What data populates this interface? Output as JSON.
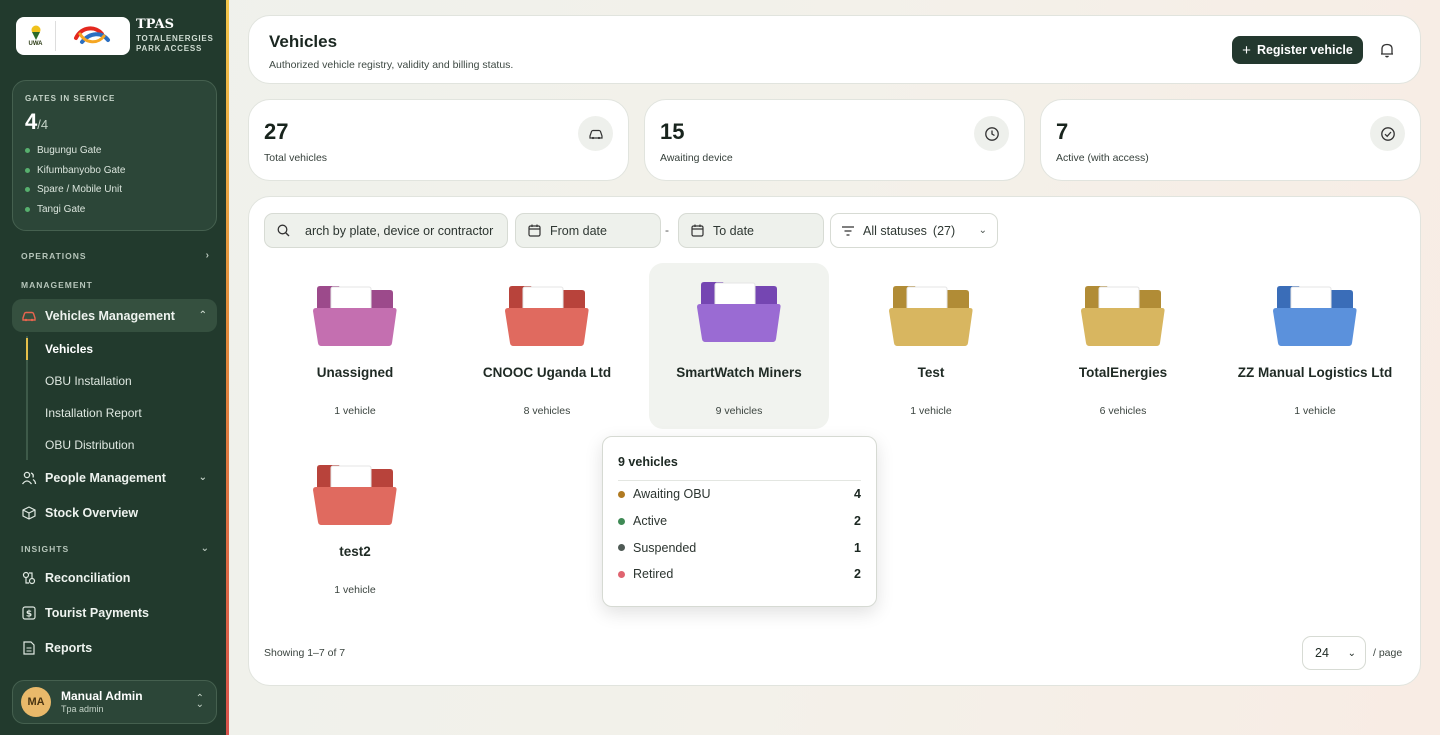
{
  "brand": {
    "title": "TPAS",
    "subtitle_line1": "TOTALENERGIES",
    "subtitle_line2": "PARK ACCESS",
    "uwa_logo_text": "UWA"
  },
  "gates": {
    "label": "GATES IN SERVICE",
    "in_service": "4",
    "total": "/4",
    "items": [
      "Bugungu Gate",
      "Kifumbanyobo Gate",
      "Spare / Mobile Unit",
      "Tangi Gate"
    ],
    "dot_color": "#57b06e"
  },
  "nav": {
    "operations_label": "OPERATIONS",
    "management_label": "MANAGEMENT",
    "insights_label": "INSIGHTS",
    "vehicles_management": "Vehicles Management",
    "vehicles_sub": [
      "Vehicles",
      "OBU Installation",
      "Installation Report",
      "OBU Distribution"
    ],
    "people_management": "People Management",
    "stock_overview": "Stock Overview",
    "reconciliation": "Reconciliation",
    "tourist_payments": "Tourist Payments",
    "reports": "Reports"
  },
  "user": {
    "initials": "MA",
    "name": "Manual Admin",
    "role": "Tpa admin"
  },
  "header": {
    "title": "Vehicles",
    "subtitle": "Authorized vehicle registry, validity and billing status.",
    "register_label": "Register vehicle"
  },
  "stats": [
    {
      "value": "27",
      "label": "Total vehicles",
      "icon": "car-icon"
    },
    {
      "value": "15",
      "label": "Awaiting device",
      "icon": "clock-icon"
    },
    {
      "value": "7",
      "label": "Active (with access)",
      "icon": "check-circle-icon"
    }
  ],
  "filters": {
    "search_text": "arch by plate, device or contractor",
    "from_date": "From date",
    "to_date": "To date",
    "date_separator": "-",
    "status": "All statuses",
    "status_count": "(27)"
  },
  "folders": [
    {
      "name": "Unassigned",
      "count": "1 vehicle",
      "color": "#c46fb0",
      "tab": "#9c4a8b"
    },
    {
      "name": "CNOOC Uganda Ltd",
      "count": "8 vehicles",
      "color": "#e06a5f",
      "tab": "#b8433b"
    },
    {
      "name": "SmartWatch Miners",
      "count": "9 vehicles",
      "color": "#9a6bd3",
      "tab": "#7546b2"
    },
    {
      "name": "Test",
      "count": "1 vehicle",
      "color": "#d8b660",
      "tab": "#b18c36"
    },
    {
      "name": "TotalEnergies",
      "count": "6 vehicles",
      "color": "#d8b660",
      "tab": "#b18c36"
    },
    {
      "name": "ZZ Manual Logistics Ltd",
      "count": "1 vehicle",
      "color": "#5b91dc",
      "tab": "#3a6db8"
    },
    {
      "name": "test2",
      "count": "1 vehicle",
      "color": "#e06a5f",
      "tab": "#b8433b"
    }
  ],
  "tooltip": {
    "title": "9 vehicles",
    "rows": [
      {
        "label": "Awaiting OBU",
        "value": "4",
        "color": "#b07a22"
      },
      {
        "label": "Active",
        "value": "2",
        "color": "#3f8a55"
      },
      {
        "label": "Suspended",
        "value": "1",
        "color": "#4f5a55"
      },
      {
        "label": "Retired",
        "value": "2",
        "color": "#e06470"
      }
    ]
  },
  "pagination": {
    "showing": "Showing 1–7 of 7",
    "per_page": "24",
    "per_page_label": "/ page"
  }
}
